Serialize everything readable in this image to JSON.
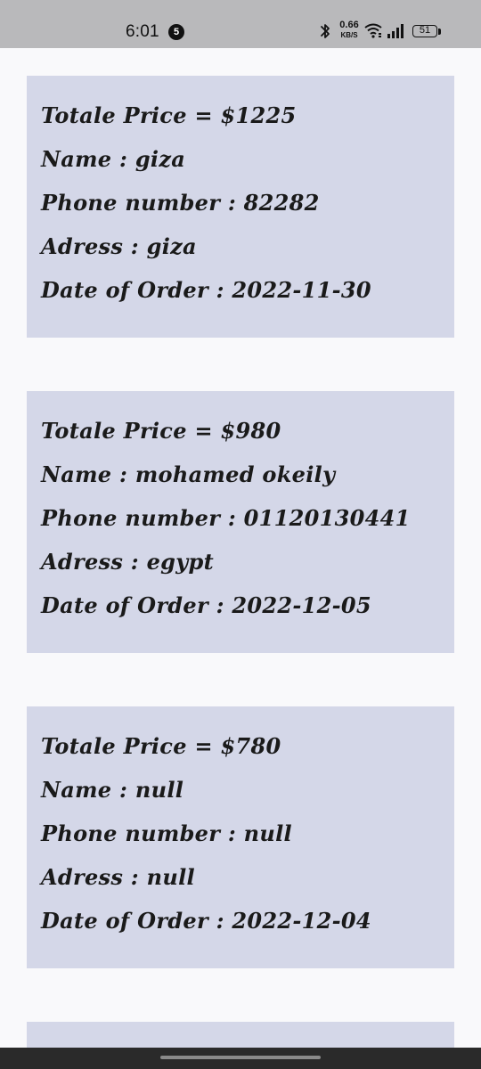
{
  "status_bar": {
    "time": "6:01",
    "notification_count": "5",
    "net_speed_value": "0.66",
    "net_speed_unit": "KB/S",
    "battery_level": "51",
    "icons": [
      "bluetooth-icon",
      "wifi-icon",
      "signal-icon",
      "battery-icon"
    ]
  },
  "orders": [
    {
      "total": "Totale Price = $1225",
      "name": "Name : giza",
      "phone": "Phone number : 82282",
      "address": "Adress : giza",
      "date": "Date of Order : 2022-11-30"
    },
    {
      "total": "Totale Price = $980",
      "name": "Name : mohamed okeily",
      "phone": "Phone number : 01120130441",
      "address": "Adress : egypt",
      "date": "Date of Order : 2022-12-05"
    },
    {
      "total": "Totale Price = $780",
      "name": "Name : null",
      "phone": "Phone number : null",
      "address": "Adress : null",
      "date": "Date of Order : 2022-12-04"
    }
  ],
  "colors": {
    "card_background": "#d4d7e8",
    "page_background": "#f9f9fb",
    "status_bar": "#b9b9bb",
    "text": "#1a1a1a"
  }
}
